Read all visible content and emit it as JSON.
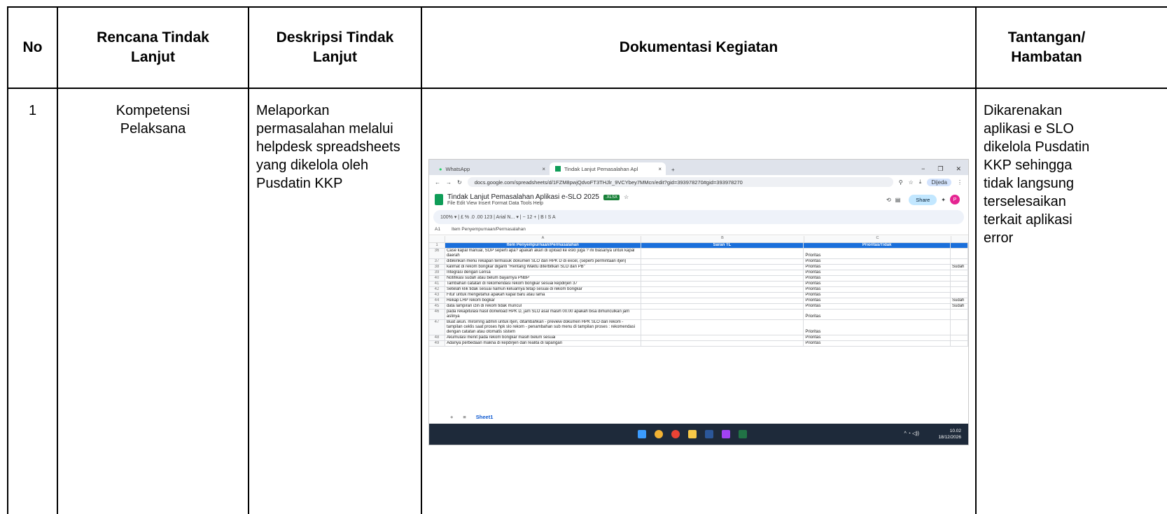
{
  "table": {
    "headers": {
      "no": "No",
      "rencana": "Rencana Tindak Lanjut",
      "deskripsi": "Deskripsi Tindak Lanjut",
      "dokumentasi": "Dokumentasi Kegiatan",
      "tantangan": "Tantangan/ Hambatan"
    },
    "rows": [
      {
        "no": "1",
        "rencana": "Kompetensi Pelaksana",
        "deskripsi": "Melaporkan permasalahan melalui helpdesk spreadsheets yang dikelola oleh Pusdatin KKP",
        "tantangan": "Dikarenakan aplikasi e SLO dikelola Pusdatin KKP sehingga tidak langsung terselesaikan terkait aplikasi error"
      }
    ]
  },
  "screenshot": {
    "tabs": [
      "WhatsApp",
      "Tindak Lanjut Pemasalahan Apl"
    ],
    "url": "docs.google.com/spreadsheets/d/1FZM8pwjQdvoFT3THJlr_9VCYbey7MMcn/edit?gid=393978270#gid=393978270",
    "profile": "Dijeda",
    "doc_title": "Tindak Lanjut Pemasalahan Aplikasi e-SLO 2025",
    "file_badge": ".XLSX",
    "menus": "File   Edit   View   Insert   Format   Data   Tools   Help",
    "share": "Share",
    "avatar": "P",
    "toolbar": "100%  ▾   |  £   %   .0   .00   123   |   Arial N...  ▾   |   −  12  +   |   B   I   S   A",
    "cell_ref": "A1",
    "formula": "Item Penyempurnaan/Permasalahan",
    "col_letters": [
      "A",
      "B",
      "C"
    ],
    "col_headers": [
      "Item Penyempurnaan/Permasalahan",
      "Saran TL",
      "Prioritas/Tidak"
    ],
    "sheet_rows": [
      {
        "n": "36",
        "a": "Case kapal manual, SOP seperti apa? apakah akan di upload ke eslo juga ? ini biasanya untuk kapal daerah",
        "c": "Prioritas",
        "d": ""
      },
      {
        "n": "37",
        "a": "dibikinkan menu rekapan termasuk dokumen SLO dan HPK D di excel, (seperti permintaan itjen)",
        "c": "Prioritas",
        "d": ""
      },
      {
        "n": "38",
        "a": "kalimat di rekom bongkar diganti \"Rentang Waktu diterbitkan SLO dan PB\"",
        "c": "Prioritas",
        "d": "Sudah"
      },
      {
        "n": "39",
        "a": "Integrasi dengan Lensa",
        "c": "Prioritas",
        "d": ""
      },
      {
        "n": "40",
        "a": "Notifikasi sudah atau belum bayarnya PNBP",
        "c": "Prioritas",
        "d": ""
      },
      {
        "n": "41",
        "a": "Tambahan catatan di rekomendasi rekom bongkar sesuai kepdirjen 37",
        "c": "Prioritas",
        "d": ""
      },
      {
        "n": "42",
        "a": "Setelah klik tidak sesuai namun keluarnya tetap sesuai di rekom bongkar",
        "c": "Prioritas",
        "d": ""
      },
      {
        "n": "43",
        "a": "Fitur untuk mengetahui apakah kapal baru atau lama",
        "c": "Prioritas",
        "d": ""
      },
      {
        "n": "44",
        "a": "Rekap LHP rekom bogkar",
        "c": "Prioritas",
        "d": "Sudah"
      },
      {
        "n": "45",
        "a": "data lampiran izin di rekom tidak muncul",
        "c": "Prioritas",
        "d": "Sudah"
      },
      {
        "n": "46",
        "a": "pada rekapitulasi hasil donwload HPK D, jam SLO asal masih 00.00 apakah bisa dimunculkan jam aslinya",
        "c": "Prioritas",
        "d": ""
      },
      {
        "n": "47",
        "a": "Buat akun. mirorring admin untuk itjen, ditambahkan - preview dokumen HPK SLO dan rekom - tampilan ceklis saat proses hpk slo rekom - penambahan sub menu di tampilan proses : rekomendasi dengan catatan atau otomatis sistem",
        "c": "Prioritas",
        "d": ""
      },
      {
        "n": "48",
        "a": "Akumulasi menit pada rekom bongkar masih belum sesuai",
        "c": "Prioritas",
        "d": ""
      },
      {
        "n": "49",
        "a": "Adanya perbedaan makna di kepdirjen dan realita di lapangan",
        "c": "Prioritas",
        "d": ""
      }
    ],
    "sheet_tab": "Sheet1",
    "clock_time": "10.02",
    "clock_date": "18/12/2026"
  }
}
